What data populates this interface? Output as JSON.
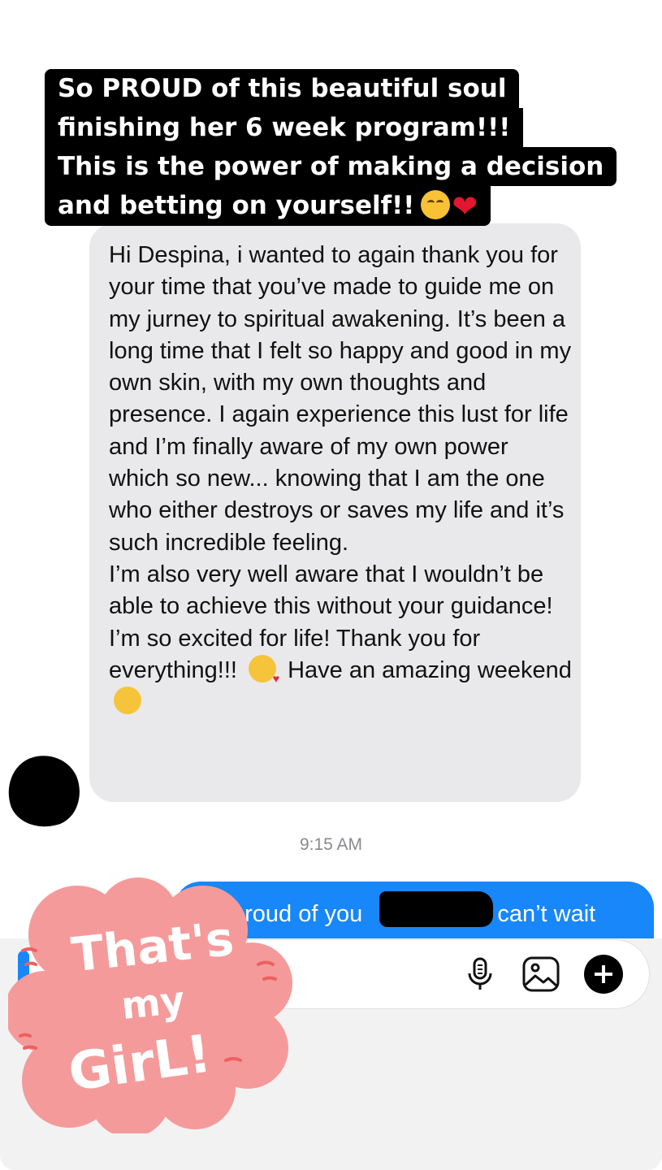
{
  "caption": {
    "lines": [
      "So PROUD of this beautiful soul",
      "finishing her 6 week program!!!",
      "This is the power of making a decision",
      "and betting on yourself!!"
    ]
  },
  "conversation": {
    "incoming_message": {
      "text": "Hi Despina, i wanted to again thank you for your time that you’ve made to guide me on my jurney to spiritual awakening. It’s been a long time that I felt so happy and good in my own skin, with my own thoughts and presence. I again experience this lust for life and I’m finally aware of my own power which so new... knowing that I am the one who either destroys or saves my life and it’s such incredible feeling.\nI’m also very well aware that I wouldn’t be able to achieve this without your guidance! I’m so excited for life! Thank you for everything!!!",
      "text_after_emoji": "Have an amazing weekend"
    },
    "timestamp": "9:15 AM",
    "outgoing_message": {
      "text_before": "proud of you",
      "text_after": "I can’t wait"
    }
  },
  "sticker": {
    "text": "That's my GirL!"
  },
  "compose": {
    "icons": [
      "microphone-icon",
      "photo-icon",
      "plus-icon"
    ]
  },
  "colors": {
    "incoming_bubble": "#e9e9eb",
    "outgoing_bubble": "#1787fa",
    "caption_bg": "#000000",
    "sticker_pink": "#f48c8c"
  }
}
